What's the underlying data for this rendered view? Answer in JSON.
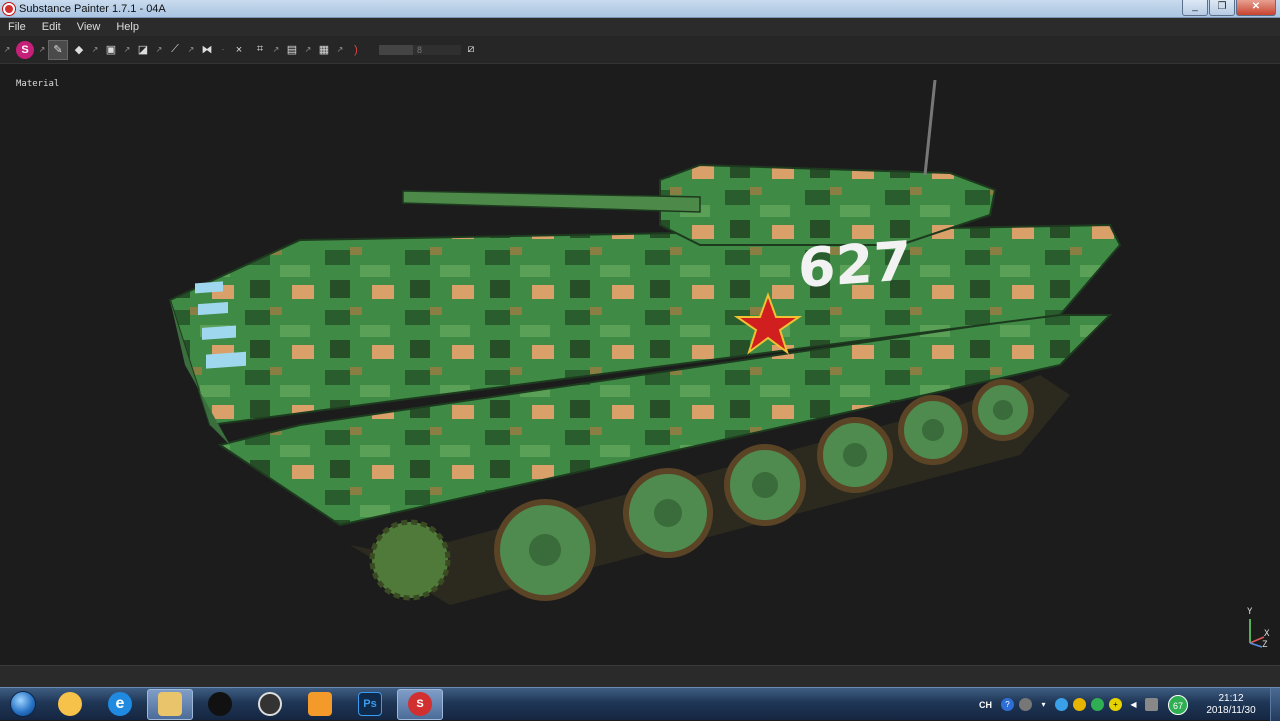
{
  "window": {
    "title": "Substance Painter 1.7.1 - 04A",
    "minimize": "_",
    "restore": "❐",
    "close": "✕"
  },
  "menu": [
    "File",
    "Edit",
    "View",
    "Help"
  ],
  "toolbar": {
    "logo": "S",
    "slider_value": "8"
  },
  "viewport": {
    "mode_label": "Material",
    "vehicle_number": "627"
  },
  "gizmo": {
    "y": "Y",
    "x": "X",
    "z": "Z"
  },
  "taskbar": {
    "apps": [
      {
        "name": "windows-explorer-icon",
        "label": "",
        "color": "#f6c24a"
      },
      {
        "name": "internet-explorer-icon",
        "label": "e",
        "color": "#1f8ae0"
      },
      {
        "name": "file-explorer-icon",
        "label": "",
        "color": "#e9c46a"
      },
      {
        "name": "qq-icon",
        "label": "",
        "color": "#111111"
      },
      {
        "name": "obs-icon",
        "label": "",
        "color": "#333333"
      },
      {
        "name": "uc-browser-icon",
        "label": "",
        "color": "#f39a2b"
      },
      {
        "name": "photoshop-icon",
        "label": "Ps",
        "color": "#0f2a4a"
      },
      {
        "name": "substance-painter-icon",
        "label": "S",
        "color": "#d23030"
      }
    ],
    "lang": "CH",
    "battery_badge": "67",
    "time": "21:12",
    "date": "2018/11/30"
  }
}
